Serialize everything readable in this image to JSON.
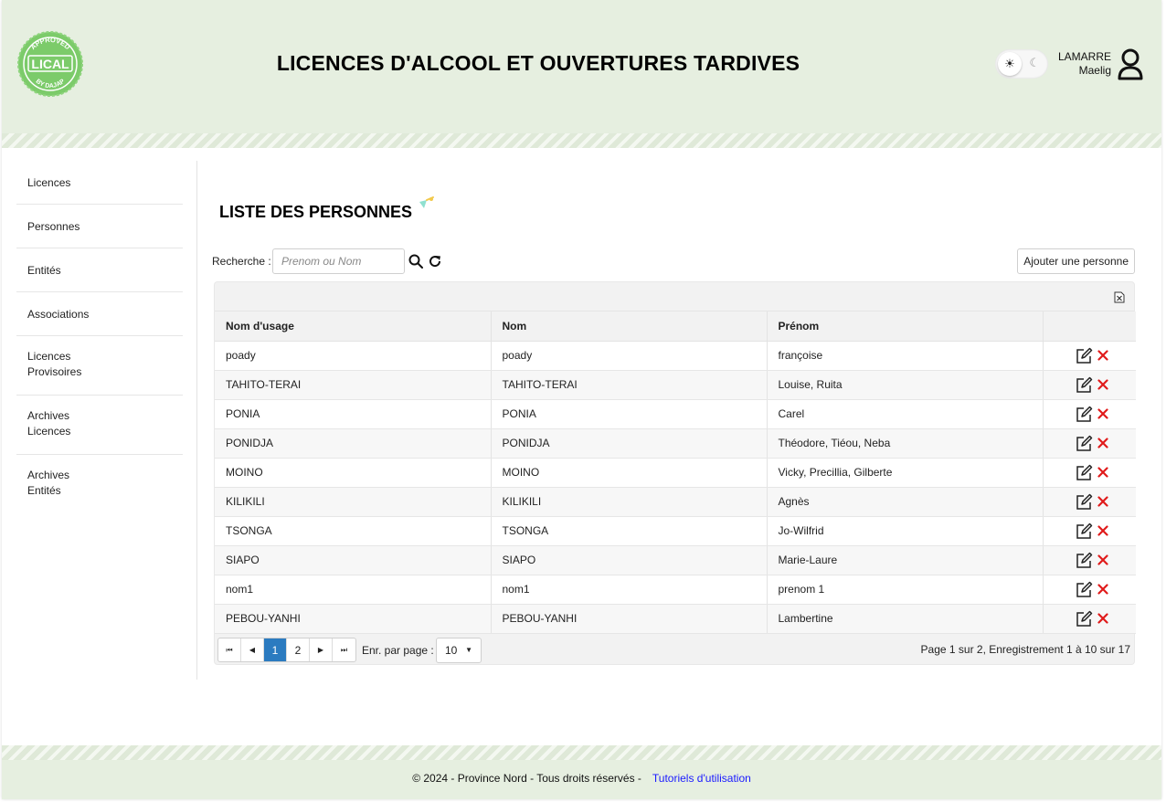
{
  "header": {
    "title": "LICENCES D'ALCOOL ET OUVERTURES TARDIVES",
    "logo": {
      "line_top": "APPROVED",
      "line_mid": "LICAL",
      "line_bottom": "BY DAJAP"
    },
    "theme": {
      "light_icon": "☀",
      "dark_icon": "☾"
    },
    "user": {
      "last_name": "LAMARRE",
      "first_name": "Maelig"
    }
  },
  "sidebar": {
    "items": [
      {
        "line1": "Licences",
        "line2": ""
      },
      {
        "line1": "Personnes",
        "line2": ""
      },
      {
        "line1": "Entités",
        "line2": ""
      },
      {
        "line1": "Associations",
        "line2": ""
      },
      {
        "line1": "Licences",
        "line2": "Provisoires"
      },
      {
        "line1": "Archives",
        "line2": "Licences"
      },
      {
        "line1": "Archives",
        "line2": "Entités"
      }
    ]
  },
  "main": {
    "title": "LISTE DES PERSONNES",
    "search": {
      "label": "Recherche :",
      "placeholder": "Prenom ou Nom",
      "value": ""
    },
    "add_button": "Ajouter une personne",
    "table": {
      "columns": [
        "Nom d'usage",
        "Nom",
        "Prénom",
        ""
      ],
      "rows": [
        [
          "poady",
          "poady",
          "françoise"
        ],
        [
          "TAHITO-TERAI",
          "TAHITO-TERAI",
          "Louise, Ruita"
        ],
        [
          "PONIA",
          "PONIA",
          "Carel"
        ],
        [
          "PONIDJA",
          "PONIDJA",
          "Théodore, Tiéou, Neba"
        ],
        [
          "MOINO",
          "MOINO",
          "Vicky, Precillia, Gilberte"
        ],
        [
          "KILIKILI",
          "KILIKILI",
          "Agnès"
        ],
        [
          "TSONGA",
          "TSONGA",
          "Jo-Wilfrid"
        ],
        [
          "SIAPO",
          "SIAPO",
          "Marie-Laure"
        ],
        [
          "nom1",
          "nom1",
          "prenom 1"
        ],
        [
          "PEBOU-YANHI",
          "PEBOU-YANHI",
          "Lambertine"
        ]
      ]
    },
    "pager": {
      "first": "⏮",
      "prev": "◀",
      "pages": [
        "1",
        "2"
      ],
      "current_page": "1",
      "next": "▶",
      "last": "⏭",
      "per_page_label": "Enr. par page :",
      "per_page_value": "10",
      "info": "Page 1 sur 2, Enregistrement 1 à 10 sur 17"
    }
  },
  "footer": {
    "text": "© 2024 - Province Nord - Tous droits réservés -",
    "link": "Tutoriels d'utilisation"
  },
  "colors": {
    "header_bg": "#e6efe0",
    "logo_green": "#7ccb6a",
    "accent_blue": "#2b7bc0",
    "delete_red": "#e01b1b",
    "link_blue": "#1a1aff"
  }
}
